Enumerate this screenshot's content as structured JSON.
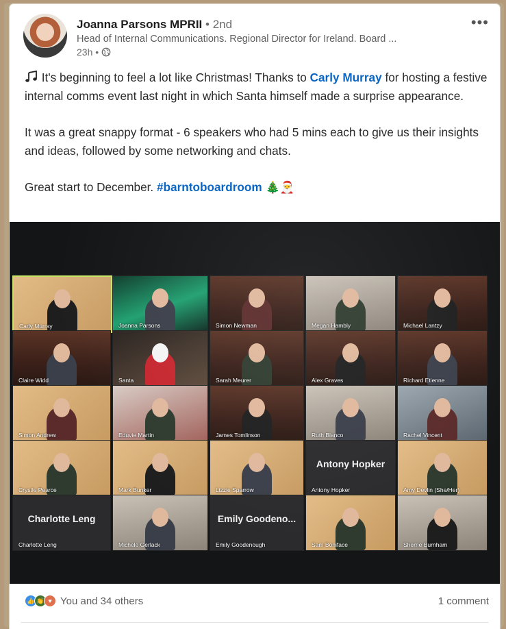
{
  "post": {
    "author": {
      "name": "Joanna Parsons MPRII",
      "degree": "• 2nd",
      "headline": "Head of Internal Communications. Regional Director for Ireland. Board ...",
      "time": "23h •"
    },
    "text": {
      "p1_before": "It's beginning to feel a lot like Christmas! Thanks to ",
      "mention": "Carly Murray",
      "p1_after": " for hosting a festive internal comms event last night in which Santa himself made a surprise appearance.",
      "p2": "It was a great snappy format - 6 speakers who had 5 mins each to give us their insights and ideas, followed by some networking and chats.",
      "p3_before": "Great start to December. ",
      "hashtag": "#barntoboardroom",
      "p3_emoji": "🎄🎅"
    },
    "photo_participants": [
      "Carly Murray",
      "Joanna Parsons",
      "Simon Newman",
      "Megan Hambly",
      "Michael Lantzy",
      "Claire Widd",
      "Santa",
      "Sarah Meurer",
      "Alex Graves",
      "Richard Etienne",
      "Simon Andrew",
      "Eduvie Martin",
      "James Tomlinson",
      "Ruth Blanco",
      "Rachel Vincent",
      "Crystle Pearce",
      "Mark Bunker",
      "Lizzie Sparrow",
      "Antony Hopker",
      "Amy Devlin (She/Her)",
      "Charlotte Leng",
      "Michele Gerlack",
      "Emily Goodenough",
      "Sam Boniface",
      "Sherrie Burnham"
    ],
    "big_names": {
      "antony": "Antony Hopker",
      "charlotte": "Charlotte Leng",
      "emily": "Emily Goodeno..."
    },
    "footer": {
      "reactions_text": "You and 34 others",
      "comments": "1 comment"
    }
  },
  "colors": {
    "link": "#0a66c2",
    "like": "#378fe9",
    "celebrate": "#44712e",
    "love": "#df704d"
  }
}
